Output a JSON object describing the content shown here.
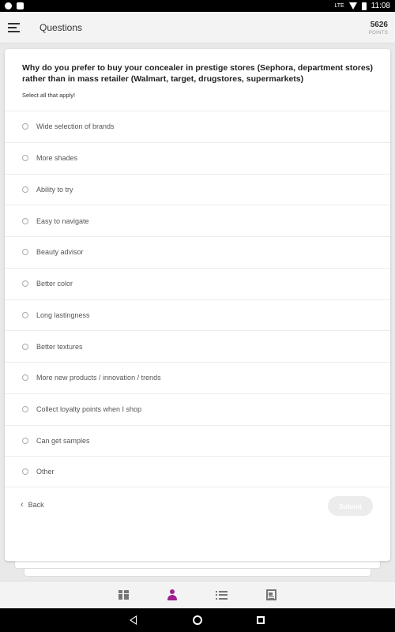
{
  "status_bar": {
    "time": "11:08",
    "network": "LTE"
  },
  "app_bar": {
    "title": "Questions",
    "points_value": "5626",
    "points_label": "POINTS"
  },
  "survey": {
    "question": "Why do you prefer to buy your concealer in prestige stores (Sephora, department stores) rather than in mass retailer (Walmart, target, drugstores, supermarkets)",
    "instruction": "Select all that apply!",
    "options": [
      "Wide selection of brands",
      "More shades",
      "Ability to try",
      "Easy to navigate",
      "Beauty advisor",
      "Better color",
      "Long lastingness",
      "Better textures",
      "More new products / innovation / trends",
      "Collect loyalty points when I shop",
      "Can get samples",
      "Other"
    ],
    "back_label": "Back",
    "submit_label": "Submit"
  },
  "tabs": [
    {
      "icon": "gift-icon"
    },
    {
      "icon": "profile-icon",
      "active": true
    },
    {
      "icon": "list-icon"
    },
    {
      "icon": "news-icon"
    }
  ],
  "colors": {
    "accent": "#a0208f",
    "submit_disabled": "#ececec"
  }
}
